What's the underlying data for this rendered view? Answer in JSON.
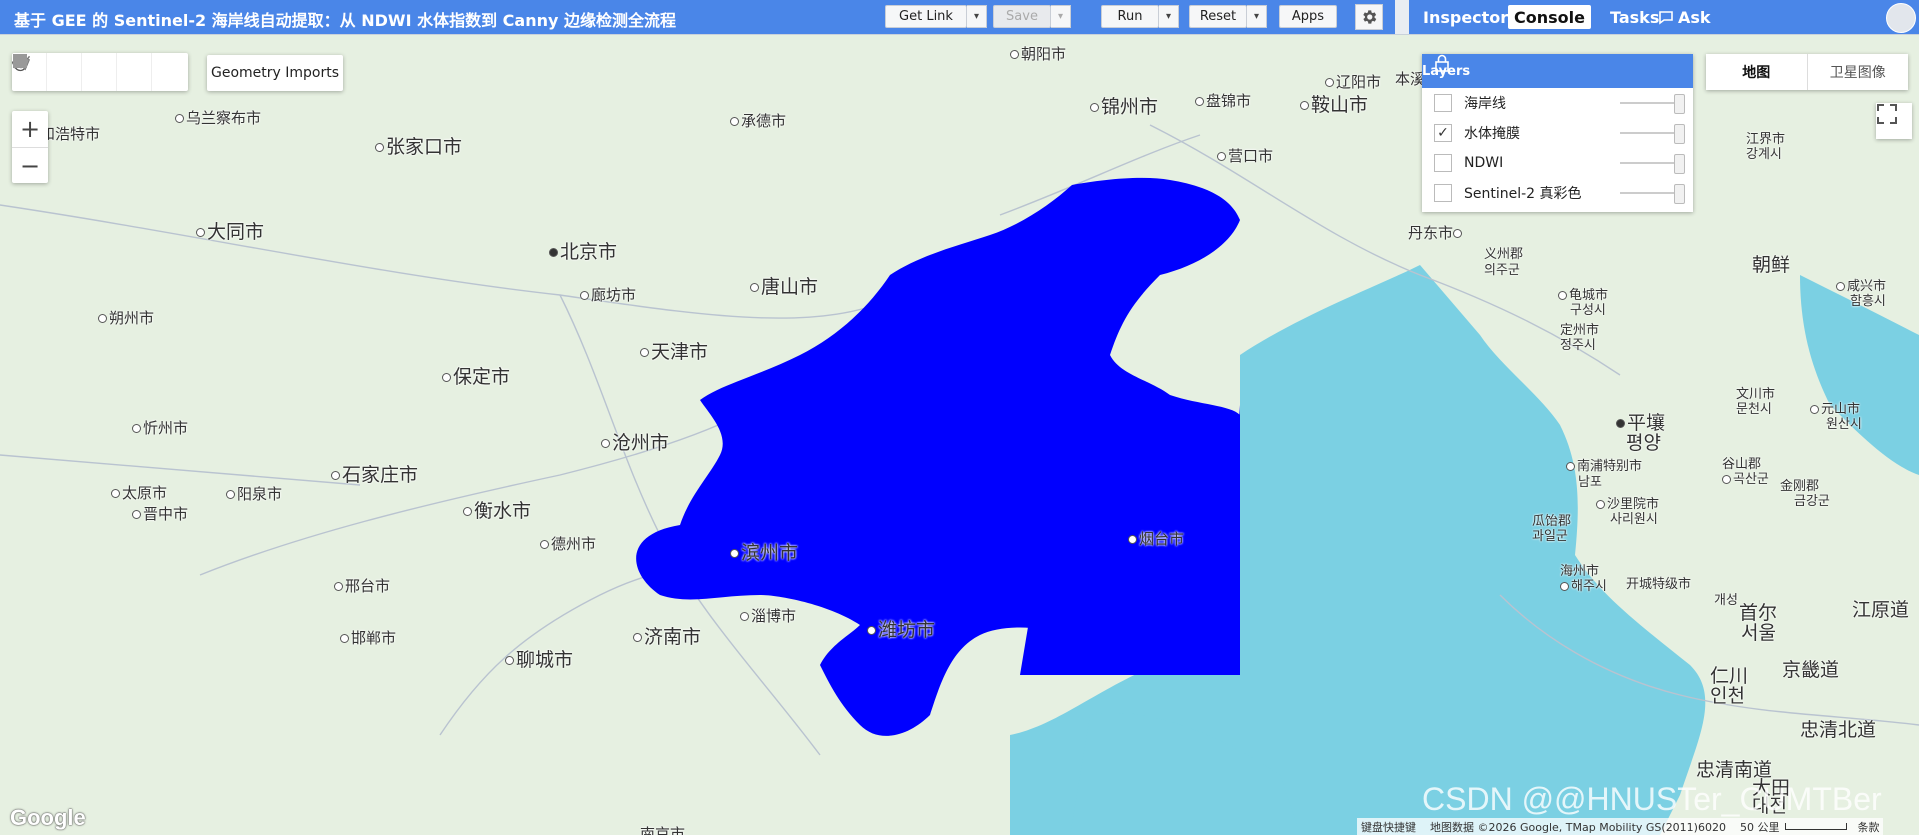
{
  "toolbar": {
    "title": "基于 GEE 的 Sentinel-2 海岸线自动提取：从 NDWI 水体指数到 Canny 边缘检测全流程",
    "get_link": "Get Link",
    "save": "Save",
    "run": "Run",
    "reset": "Reset",
    "apps": "Apps",
    "dropdown_glyph": "▾"
  },
  "right_tabs": [
    {
      "label": "Inspector",
      "active": false
    },
    {
      "label": "Console",
      "active": true
    },
    {
      "label": "Tasks",
      "active": false
    },
    {
      "label": "Ask",
      "active": false
    }
  ],
  "map_controls": {
    "geometry_imports": "Geometry Imports",
    "zoom_in": "+",
    "zoom_out": "−",
    "map_types": [
      "地图",
      "卫星图像"
    ]
  },
  "layers_panel": {
    "title": "Layers",
    "items": [
      {
        "label": "海岸线",
        "checked": false
      },
      {
        "label": "水体掩膜",
        "checked": true
      },
      {
        "label": "NDWI",
        "checked": false
      },
      {
        "label": "Sentinel-2 真彩色",
        "checked": false
      }
    ]
  },
  "cities": [
    {
      "name": "朝阳市"
    },
    {
      "name": "乌兰察布市"
    },
    {
      "name": "承德市"
    },
    {
      "name": "锦州市"
    },
    {
      "name": "盘锦市"
    },
    {
      "name": "鞍山市"
    },
    {
      "name": "辽阳市"
    },
    {
      "name": "本溪"
    },
    {
      "name": "和浩特市"
    },
    {
      "name": "张家口市"
    },
    {
      "name": "大同市"
    },
    {
      "name": "北京市"
    },
    {
      "name": "唐山市"
    },
    {
      "name": "廊坊市"
    },
    {
      "name": "朔州市"
    },
    {
      "name": "天津市"
    },
    {
      "name": "保定市"
    },
    {
      "name": "沧州市"
    },
    {
      "name": "忻州市"
    },
    {
      "name": "石家庄市"
    },
    {
      "name": "太原市"
    },
    {
      "name": "阳泉市"
    },
    {
      "name": "衡水市"
    },
    {
      "name": "晋中市"
    },
    {
      "name": "德州市"
    },
    {
      "name": "滨州市"
    },
    {
      "name": "邢台市"
    },
    {
      "name": "淄博市"
    },
    {
      "name": "邯郸市"
    },
    {
      "name": "济南市"
    },
    {
      "name": "潍坊市"
    },
    {
      "name": "聊城市"
    },
    {
      "name": "烟台市"
    },
    {
      "name": "营口市"
    },
    {
      "name": "丹东市"
    },
    {
      "name": "义州郡"
    },
    {
      "name": "의주군"
    },
    {
      "name": "龟城市"
    },
    {
      "name": "구성시"
    },
    {
      "name": "定州市"
    },
    {
      "name": "정주시"
    },
    {
      "name": "朝鲜"
    },
    {
      "name": "咸兴市"
    },
    {
      "name": "함흥시"
    },
    {
      "name": "江界市"
    },
    {
      "name": "강계시"
    },
    {
      "name": "文川市"
    },
    {
      "name": "문천시"
    },
    {
      "name": "元山市"
    },
    {
      "name": "원산시"
    },
    {
      "name": "平壤"
    },
    {
      "name": "평양"
    },
    {
      "name": "南浦特别市"
    },
    {
      "name": "남포"
    },
    {
      "name": "谷山郡"
    },
    {
      "name": "곡산군"
    },
    {
      "name": "沙里院市"
    },
    {
      "name": "사리원시"
    },
    {
      "name": "瓜饴郡"
    },
    {
      "name": "과일군"
    },
    {
      "name": "金刚郡"
    },
    {
      "name": "금강군"
    },
    {
      "name": "海州市"
    },
    {
      "name": "해주시"
    },
    {
      "name": "开城特级市"
    },
    {
      "name": "개성"
    },
    {
      "name": "首尔"
    },
    {
      "name": "서울"
    },
    {
      "name": "江原道"
    },
    {
      "name": "京畿道"
    },
    {
      "name": "仁川"
    },
    {
      "name": "인천"
    },
    {
      "name": "忠清北道"
    },
    {
      "name": "忠清南道"
    },
    {
      "name": "大田"
    },
    {
      "name": "대전"
    },
    {
      "name": "南京市"
    }
  ],
  "attribution": {
    "shortcuts": "键盘快捷键",
    "data": "地图数据 ©2026 Google, TMap Mobility GS(2011)6020",
    "scale": "50 公里",
    "terms": "条款"
  },
  "logo": "Google",
  "watermark": "CSDN @@HNUSTer_CUMTBer",
  "colors": {
    "accent": "#4a86e8",
    "water_mask": "#0000ff",
    "sea": "#7bd0e3",
    "land": "#e6f0e1"
  }
}
